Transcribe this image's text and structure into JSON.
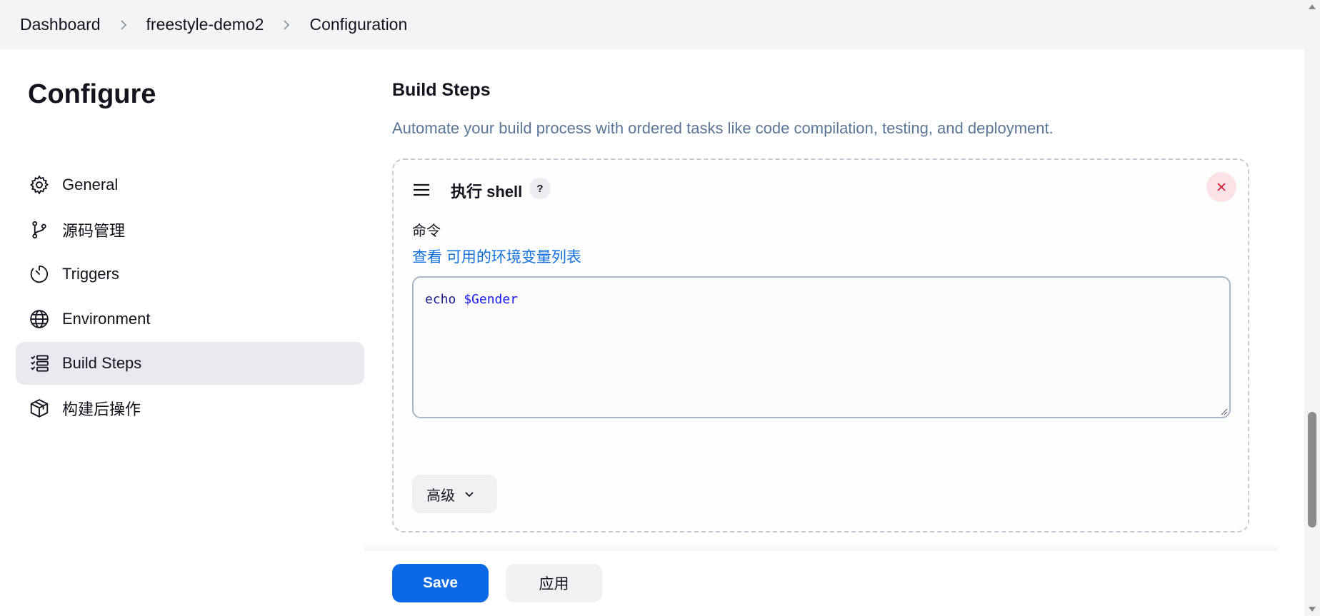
{
  "breadcrumb": {
    "items": [
      "Dashboard",
      "freestyle-demo2",
      "Configuration"
    ]
  },
  "sidebar": {
    "title": "Configure",
    "items": [
      {
        "label": "General",
        "icon": "gear-icon",
        "active": false
      },
      {
        "label": "源码管理",
        "icon": "source-branch-icon",
        "active": false
      },
      {
        "label": "Triggers",
        "icon": "timer-icon",
        "active": false
      },
      {
        "label": "Environment",
        "icon": "globe-icon",
        "active": false
      },
      {
        "label": "Build Steps",
        "icon": "list-steps-icon",
        "active": true
      },
      {
        "label": "构建后操作",
        "icon": "package-icon",
        "active": false
      }
    ]
  },
  "main": {
    "section_title": "Build Steps",
    "section_desc": "Automate your build process with ordered tasks like code compilation, testing, and deployment.",
    "step": {
      "name": "执行 shell",
      "help": "?",
      "field_label": "命令",
      "env_prefix": "查看 ",
      "env_link": "可用的环境变量列表",
      "command_keyword": "echo",
      "command_var": "$Gender",
      "advanced_label": "高级"
    }
  },
  "footer": {
    "save_label": "Save",
    "apply_label": "应用"
  },
  "colors": {
    "accent": "#0c69e6",
    "link": "#1270dd",
    "desc": "#5a7696",
    "danger_bg": "#fbe2e6",
    "danger": "#d0213a"
  }
}
